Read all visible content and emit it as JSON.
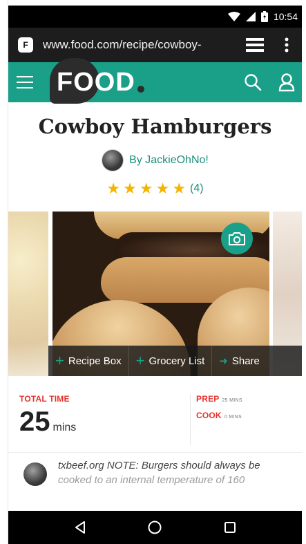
{
  "status_bar": {
    "time": "10:54",
    "icons": [
      "wifi-icon",
      "signal-icon",
      "battery-icon"
    ]
  },
  "browser": {
    "site_icon": "F",
    "url": "www.food.com/recipe/cowboy-",
    "tabs_icon": "tabs-icon",
    "menu_icon": "overflow-menu-icon"
  },
  "site_header": {
    "logo": "FOOD",
    "brand_color": "#1aa088",
    "icons": [
      "hamburger-menu-icon",
      "search-icon",
      "user-icon"
    ]
  },
  "recipe": {
    "title": "Cowboy Hamburgers",
    "author": "By JackieOhNo!",
    "rating": 5,
    "rating_count": "(4)"
  },
  "actions": {
    "recipe_box": "Recipe Box",
    "grocery_list": "Grocery List",
    "share": "Share"
  },
  "times": {
    "total_label": "TOTAL TIME",
    "total_value": "25",
    "total_unit": "mins",
    "prep_label": "PREP",
    "prep_value": "25 MINS",
    "cook_label": "COOK",
    "cook_value": "0 MINS"
  },
  "note": {
    "text_visible": "txbeef.org NOTE: Burgers should always be",
    "text_faded": "cooked to an internal temperature of 160"
  },
  "nav_bar": {
    "icons": [
      "back-icon",
      "home-icon",
      "recents-icon"
    ]
  }
}
